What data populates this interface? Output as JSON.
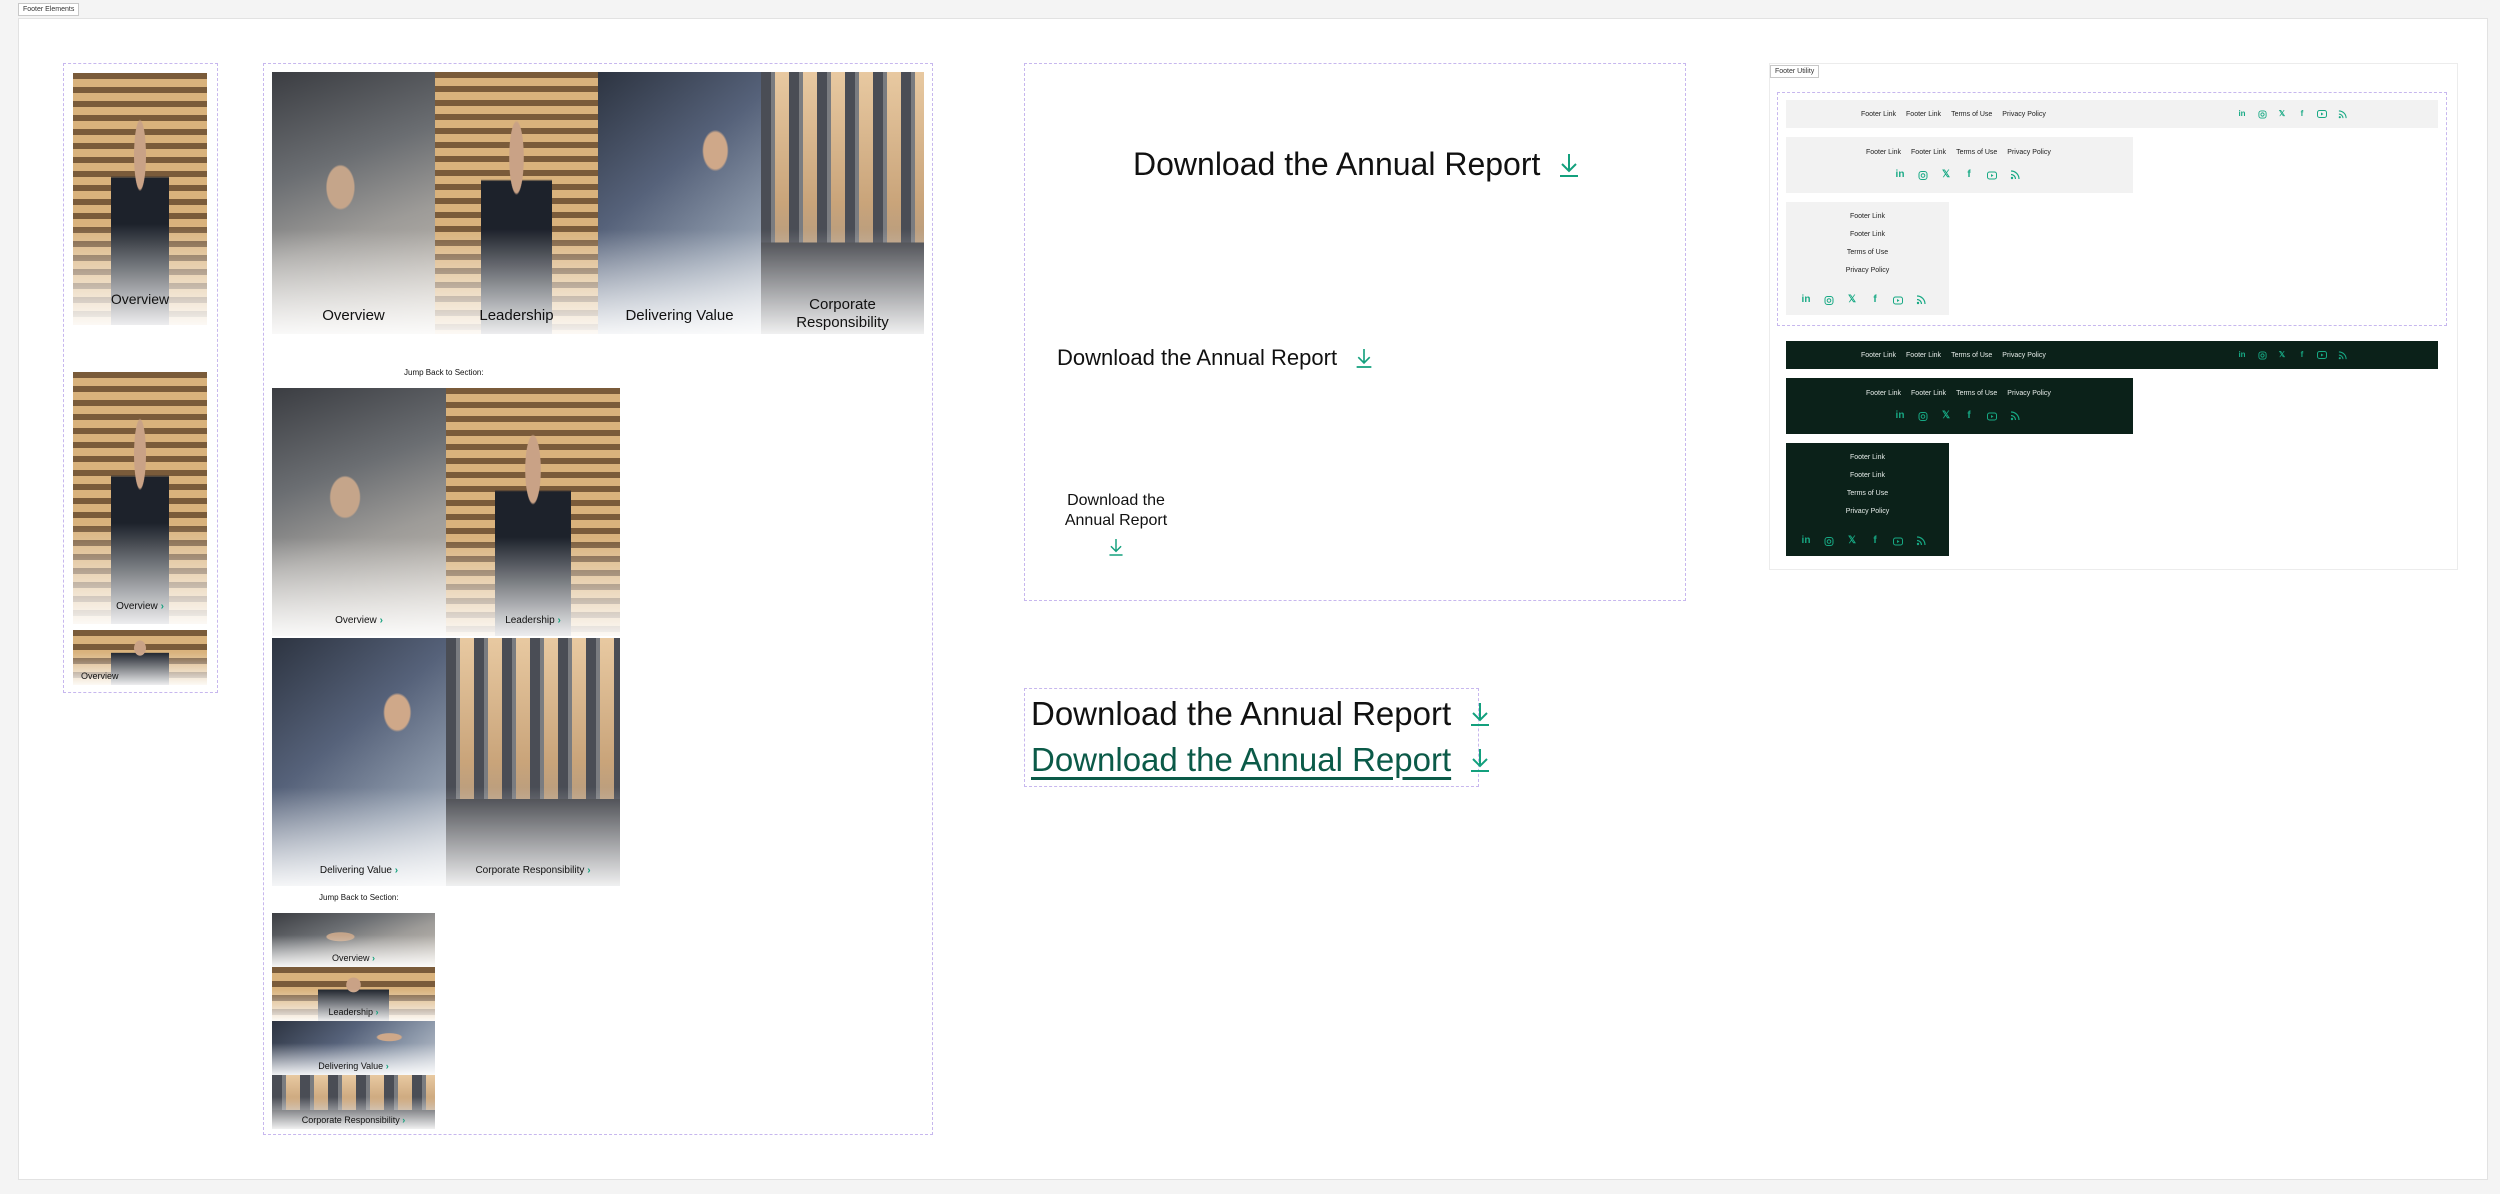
{
  "page": {
    "frame_label": "Footer Elements"
  },
  "jump_left": {
    "card1_label": "Overview",
    "card2_label": "Overview",
    "card3_label": "Overview"
  },
  "jump_main": {
    "desktop_tiles": [
      "Overview",
      "Leadership",
      "Delivering Value",
      "Corporate Responsibility"
    ],
    "jump_back_label": "Jump Back to Section:",
    "tablet_tiles": [
      "Overview",
      "Leadership",
      "Delivering Value",
      "Corporate Responsibility"
    ],
    "jump_back_label_2": "Jump Back to Section:",
    "mobile_tiles": [
      "Overview",
      "Leadership",
      "Delivering Value",
      "Corporate Responsibility"
    ]
  },
  "download": {
    "large": "Download the Annual Report",
    "medium": "Download the Annual Report",
    "small": "Download the Annual Report",
    "default_state": "Download the Annual Report",
    "hover_state": "Download the Annual Report"
  },
  "footer_utility": {
    "frame_label": "Footer Utility",
    "links": [
      "Footer Link",
      "Footer Link",
      "Terms of Use",
      "Privacy Policy"
    ],
    "social_icons": [
      "linkedin-icon",
      "instagram-icon",
      "x-icon",
      "facebook-icon",
      "youtube-icon",
      "rss-icon"
    ]
  },
  "colors": {
    "accent": "#13a07d",
    "dark_bg": "#0b2119",
    "dashed_frame": "#c7b7ee"
  }
}
